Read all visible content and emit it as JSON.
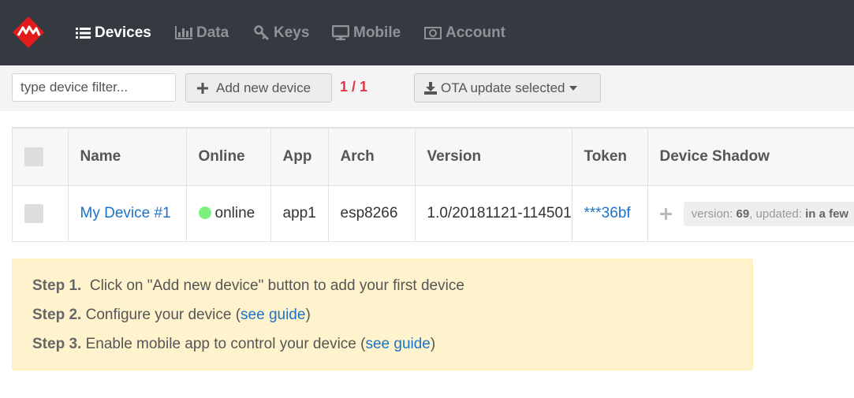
{
  "nav": {
    "logo": "logo",
    "items": [
      {
        "label": "Devices",
        "icon": "list-icon",
        "active": true
      },
      {
        "label": "Data",
        "icon": "bar-chart-icon",
        "active": false
      },
      {
        "label": "Keys",
        "icon": "key-icon",
        "active": false
      },
      {
        "label": "Mobile",
        "icon": "monitor-icon",
        "active": false
      },
      {
        "label": "Account",
        "icon": "money-icon",
        "active": false
      }
    ]
  },
  "toolbar": {
    "filter_placeholder": "type device filter...",
    "add_label": "Add new device",
    "count": "1 / 1",
    "ota_label": "OTA update selected"
  },
  "table": {
    "headers": [
      "Name",
      "Online",
      "App",
      "Arch",
      "Version",
      "Token",
      "Device Shadow"
    ],
    "rows": [
      {
        "name": "My Device #1",
        "online": "online",
        "app": "app1",
        "arch": "esp8266",
        "version": "1.0/20181121-114501",
        "token": "***36bf",
        "shadow_version_label": "version:",
        "shadow_version": "69",
        "shadow_updated_label": ", updated:",
        "shadow_updated": "in a few"
      }
    ]
  },
  "steps": {
    "s1_label": "Step 1.",
    "s1_text": "Click on \"Add new device\" button to add your first device",
    "s2_label": "Step 2.",
    "s2_text": "Configure your device (",
    "s2_link": "see guide",
    "s2_end": ")",
    "s3_label": "Step 3.",
    "s3_text": "Enable mobile app to control your device (",
    "s3_link": "see guide",
    "s3_end": ")"
  },
  "colors": {
    "topbar": "#343a40",
    "accent_red": "#dc3545",
    "link": "#1a73c8",
    "online": "#7ef07e",
    "steps_bg": "#fff3cd"
  }
}
